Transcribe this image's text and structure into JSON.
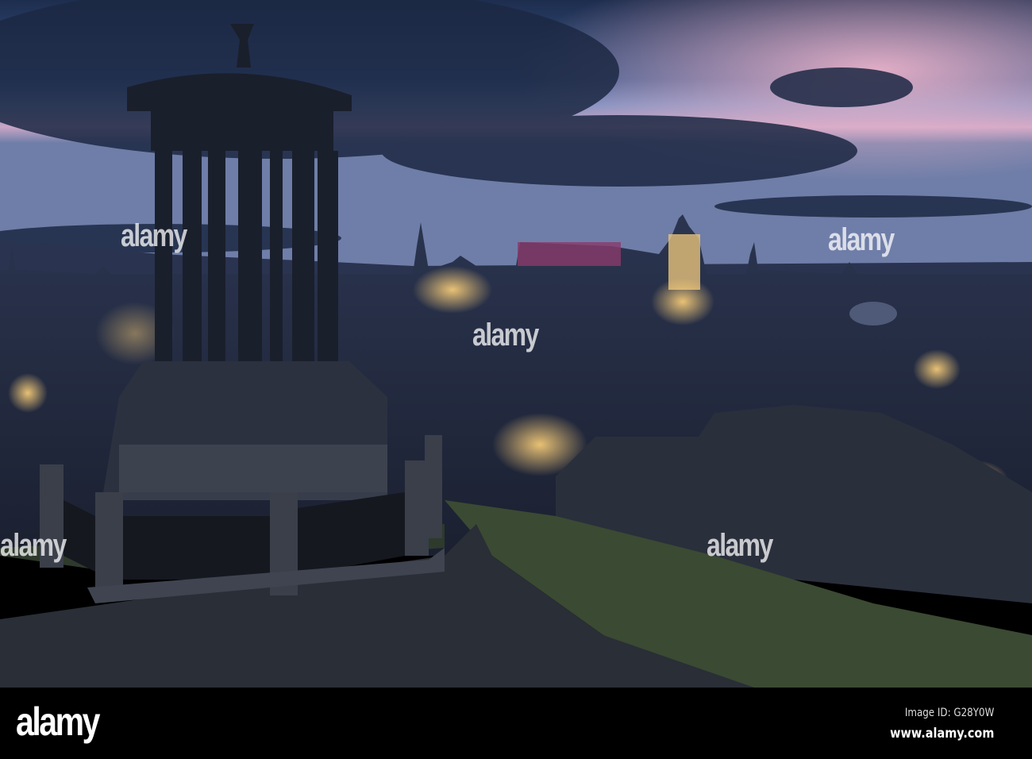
{
  "photo": {
    "subject": "Edinburgh skyline at dusk from Calton Hill",
    "watermark_text": "alamy"
  },
  "footer": {
    "logo": "alamy",
    "image_id": "Image ID: G28Y0W",
    "url": "www.alamy.com"
  }
}
